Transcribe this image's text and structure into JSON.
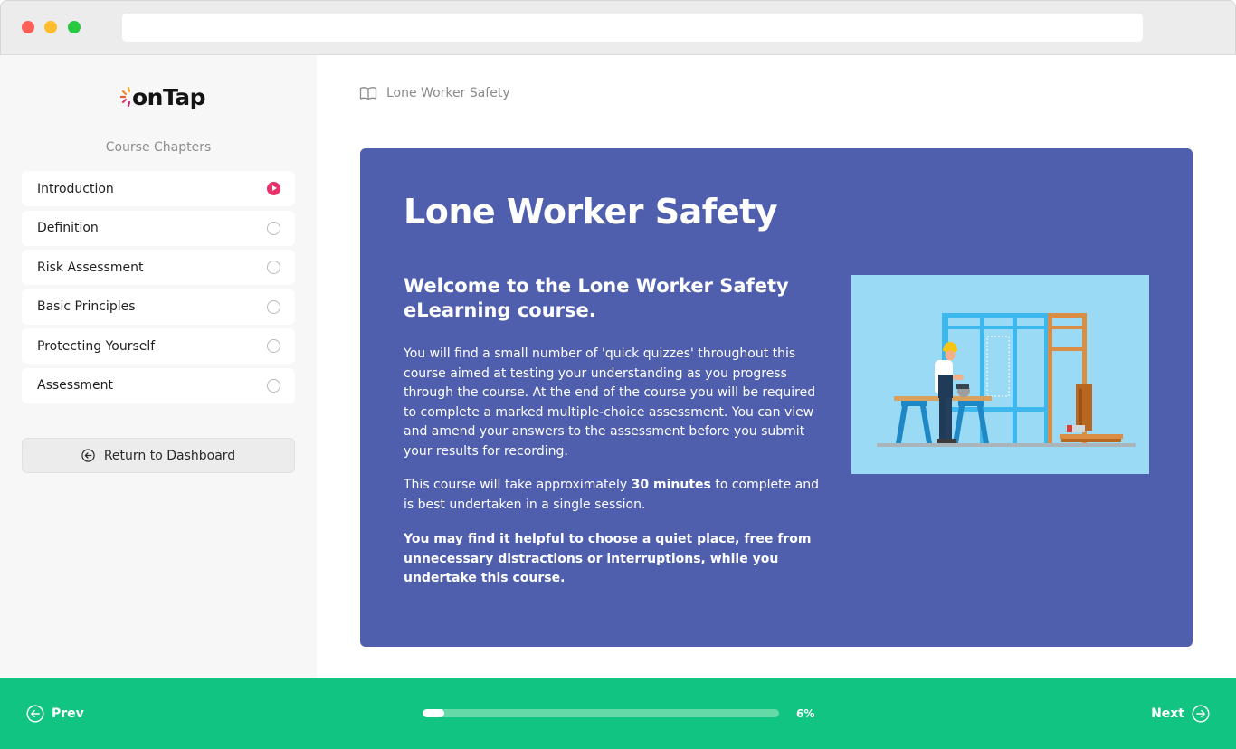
{
  "app": {
    "logo_text": "onTap"
  },
  "sidebar": {
    "heading": "Course Chapters",
    "chapters": [
      {
        "label": "Introduction",
        "status": "active"
      },
      {
        "label": "Definition",
        "status": "incomplete"
      },
      {
        "label": "Risk Assessment",
        "status": "incomplete"
      },
      {
        "label": "Basic Principles",
        "status": "incomplete"
      },
      {
        "label": "Protecting Yourself",
        "status": "incomplete"
      },
      {
        "label": "Assessment",
        "status": "incomplete"
      }
    ],
    "return_label": "Return to Dashboard"
  },
  "main": {
    "breadcrumb": "Lone Worker Safety",
    "title": "Lone Worker Safety",
    "subtitle": "Welcome to the Lone Worker Safety eLearning course.",
    "paragraph1": "You will find a small number of 'quick quizzes' throughout this course aimed at testing your understanding as you progress through the course.  At the end of the course you will be required to complete a marked multiple-choice assessment. You can view and amend your answers to the assessment before you submit your results for recording.",
    "paragraph2_before": "This course will take approximately ",
    "paragraph2_bold": "30 minutes",
    "paragraph2_after": " to complete and is best undertaken in a single session.",
    "paragraph3": "You may find it helpful to choose a quiet place, free from unnecessary distractions or interruptions, while you undertake this course.",
    "illustration": "construction-worker-sawing-illustration"
  },
  "footer": {
    "prev_label": "Prev",
    "next_label": "Next",
    "progress_fraction": 0.06,
    "progress_text": "6%"
  },
  "colors": {
    "hero_bg": "#4f5fae",
    "footer_bg": "#12c481",
    "active_chapter": "#e8316b",
    "illustration_bg": "#9adaf5"
  }
}
